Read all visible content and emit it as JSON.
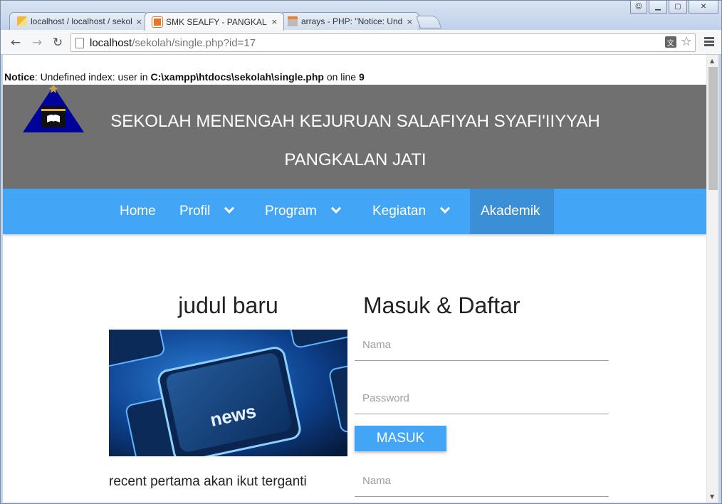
{
  "browser": {
    "tabs": [
      {
        "title": "localhost / localhost / sekolah",
        "icon": "phpmyadmin-icon",
        "active": false
      },
      {
        "title": "SMK SEALFY - PANGKALAN JATI",
        "icon": "school-favicon-icon",
        "active": true
      },
      {
        "title": "arrays - PHP: \"Notice: Undefined index\"",
        "icon": "stackoverflow-icon",
        "active": false
      }
    ],
    "close_glyph": "×",
    "url_host": "localhost",
    "url_path": "/sekolah/single.php?id=17"
  },
  "notice": {
    "label": "Notice",
    "message": ": Undefined index: user in ",
    "path": "C:\\xampp\\htdocs\\sekolah\\single.php",
    "on_line": " on line ",
    "line": "9"
  },
  "header": {
    "line1": "SEKOLAH MENENGAH KEJURUAN SALAFIYAH SYAFI'IIYYAH",
    "line2": "PANGKALAN JATI",
    "bg_color": "#6f706f"
  },
  "nav": {
    "color": "#42a5f5",
    "items": [
      {
        "label": "Home",
        "dropdown": false
      },
      {
        "label": "Profil",
        "dropdown": true
      },
      {
        "label": "Program",
        "dropdown": true
      },
      {
        "label": "Kegiatan",
        "dropdown": true
      },
      {
        "label": "Akademik",
        "dropdown": false,
        "active": true
      }
    ]
  },
  "post": {
    "title": "judul baru",
    "image_text": "news",
    "excerpt": "recent pertama akan ikut terganti"
  },
  "login": {
    "title": "Masuk & Daftar",
    "nama_placeholder": "Nama",
    "password_placeholder": "Password",
    "button": "MASUK",
    "nama2_placeholder": "Nama"
  }
}
